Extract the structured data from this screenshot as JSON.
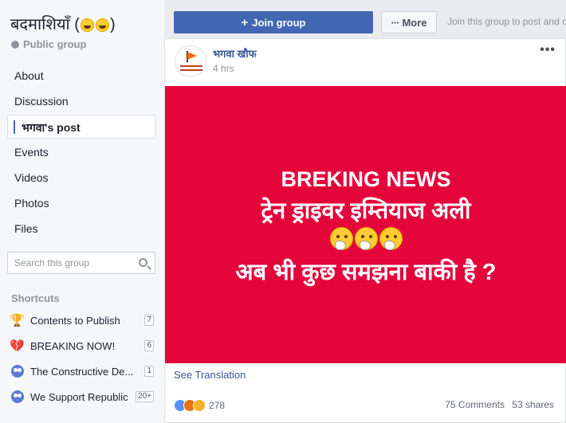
{
  "group": {
    "title": "बदमाशियाँ (😂😂)",
    "title_text": "बदमाशियाँ (",
    "title_close": ")",
    "privacy": "Public group"
  },
  "nav": {
    "items": [
      {
        "label": "About"
      },
      {
        "label": "Discussion"
      },
      {
        "label": "भगवा's post",
        "active": true
      },
      {
        "label": "Events"
      },
      {
        "label": "Videos"
      },
      {
        "label": "Photos"
      },
      {
        "label": "Files"
      }
    ]
  },
  "search": {
    "placeholder": "Search this group"
  },
  "shortcuts": {
    "title": "Shortcuts",
    "items": [
      {
        "label": "Contents to Publish",
        "badge": "7",
        "icon": "trophy-icon"
      },
      {
        "label": "BREAKING NOW!",
        "badge": "6",
        "icon": "broken-heart-icon"
      },
      {
        "label": "The Constructive De...",
        "badge": "1",
        "icon": "group-icon"
      },
      {
        "label": "We Support Republic",
        "badge": "20+",
        "icon": "group-icon"
      }
    ]
  },
  "topbar": {
    "join_label": "Join group",
    "more_label": "More",
    "join_hint": "Join this group to post and c"
  },
  "post": {
    "author": "भगवा खौफ",
    "time": "4 hrs",
    "menu": "•••",
    "image_lines": {
      "line1": "BREKING NEWS",
      "line2": "ट्रेन ड्राइवर इम्तियाज अली",
      "line4": "अब भी कुछ समझना बाकी है ?"
    },
    "image_bg": "#e4063b",
    "see_translation": "See Translation",
    "reaction_count": "278",
    "comments": "75 Comments",
    "shares": "53 shares"
  },
  "colors": {
    "accent": "#4267b2",
    "link": "#365899",
    "page_bg": "#e9ebee"
  }
}
